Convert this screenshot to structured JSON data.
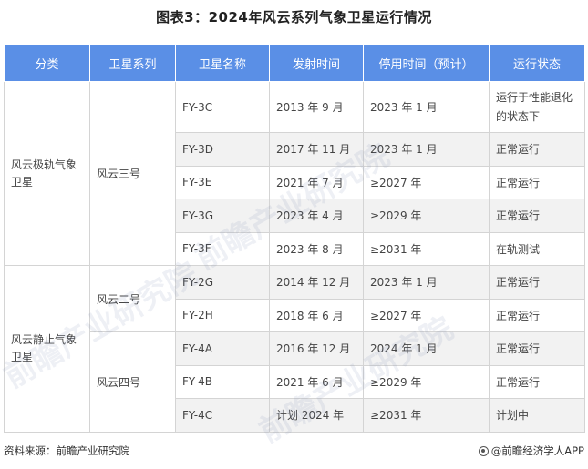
{
  "title": "图表3：2024年风云系列气象卫星运行情况",
  "headers": [
    "分类",
    "卫星系列",
    "卫星名称",
    "发射时间",
    "停用时间（预计）",
    "运行状态"
  ],
  "groups": {
    "polar": "风云极轨气象卫星",
    "geo": "风云静止气象卫星",
    "fy3": "风云三号",
    "fy2": "风云二号",
    "fy4": "风云四号"
  },
  "rows": [
    {
      "name": "FY-3C",
      "launch": "2013 年 9 月",
      "stop": "2023 年 1 月",
      "status": "运行于性能退化的状态下"
    },
    {
      "name": "FY-3D",
      "launch": "2017 年 11 月",
      "stop": "2023 年 1 月",
      "status": "正常运行"
    },
    {
      "name": "FY-3E",
      "launch": "2021 年 7 月",
      "stop": "≥2027 年",
      "status": "正常运行"
    },
    {
      "name": "FY-3G",
      "launch": "2023 年 4 月",
      "stop": "≥2029 年",
      "status": "正常运行"
    },
    {
      "name": "FY-3F",
      "launch": "2023 年 8 月",
      "stop": "≥2031 年",
      "status": "在轨测试"
    },
    {
      "name": "FY-2G",
      "launch": "2014 年 12 月",
      "stop": "2023 年 1 月",
      "status": "正常运行"
    },
    {
      "name": "FY-2H",
      "launch": "2018 年 6 月",
      "stop": "≥2027 年",
      "status": "正常运行"
    },
    {
      "name": "FY-4A",
      "launch": "2016 年 12 月",
      "stop": "2024 年 1 月",
      "status": "正常运行"
    },
    {
      "name": "FY-4B",
      "launch": "2021 年 6 月",
      "stop": "≥2029 年",
      "status": "正常运行"
    },
    {
      "name": "FY-4C",
      "launch": "计划 2024 年",
      "stop": "≥2031 年",
      "status": "计划中"
    }
  ],
  "footer": {
    "source": "资料来源：前瞻产业研究院",
    "brand": "@前瞻经济学人APP"
  },
  "watermark": "前瞻产业研究院"
}
